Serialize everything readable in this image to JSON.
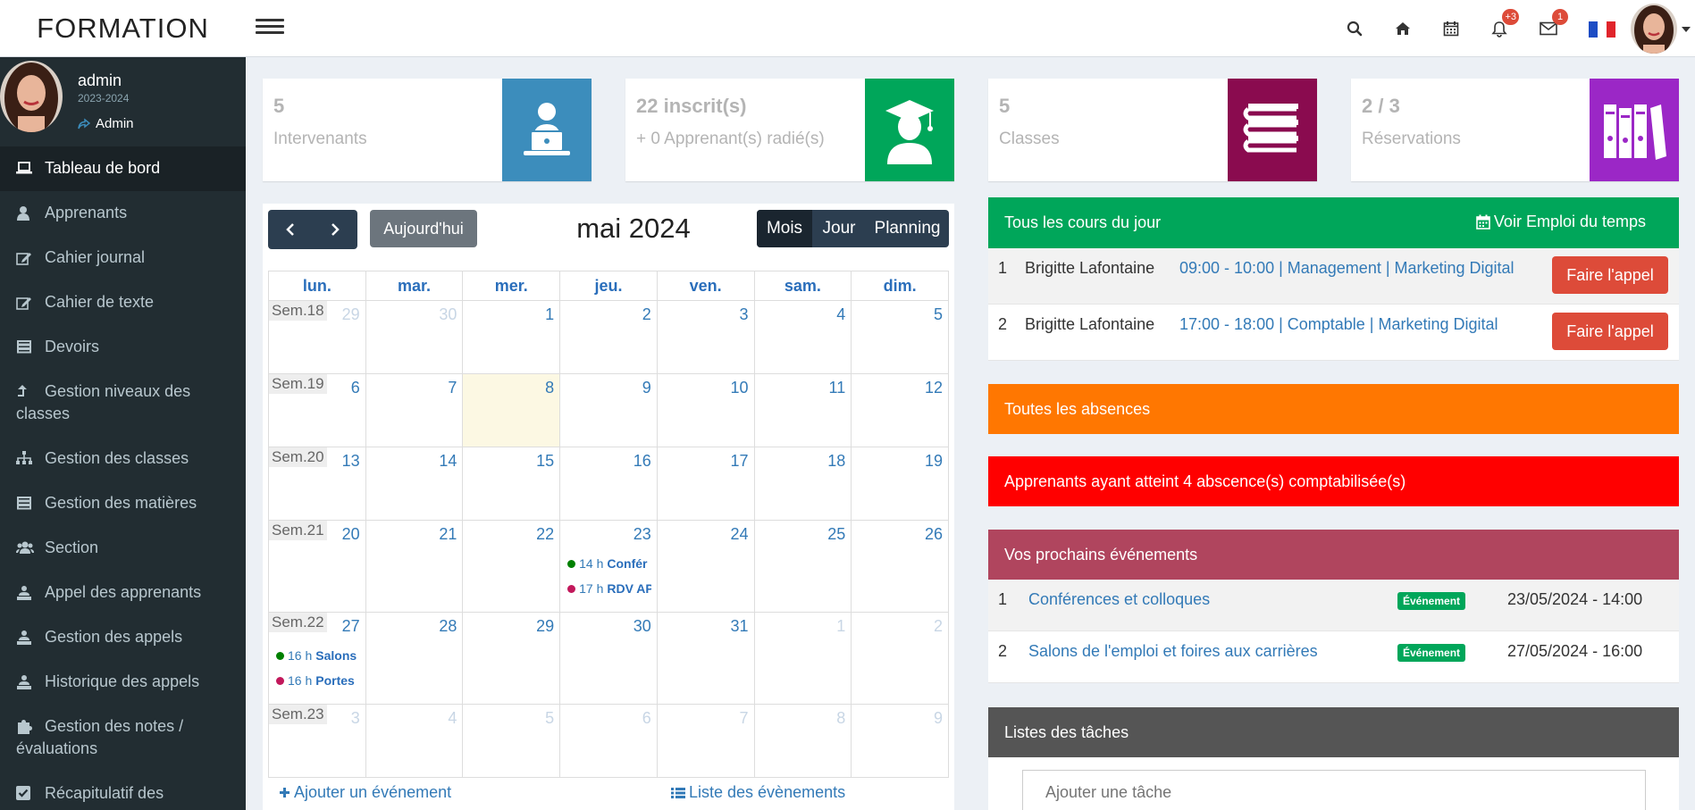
{
  "header": {
    "logo": "FORMATION",
    "badges": {
      "notifications": "+3",
      "messages": "1"
    }
  },
  "user": {
    "name": "admin",
    "year": "2023-2024",
    "role": "Admin"
  },
  "sidebar": {
    "items": [
      {
        "label": "Tableau de bord",
        "icon": "laptop-icon",
        "active": true
      },
      {
        "label": "Apprenants",
        "icon": "user-icon"
      },
      {
        "label": "Cahier journal",
        "icon": "edit-icon"
      },
      {
        "label": "Cahier de texte",
        "icon": "edit-icon"
      },
      {
        "label": "Devoirs",
        "icon": "stack-icon"
      },
      {
        "label": "Gestion niveaux des classes",
        "icon": "level-up-icon"
      },
      {
        "label": "Gestion des classes",
        "icon": "sitemap-icon"
      },
      {
        "label": "Gestion des matières",
        "icon": "stack-icon"
      },
      {
        "label": "Section",
        "icon": "users-icon"
      },
      {
        "label": "Appel des apprenants",
        "icon": "user-group-icon"
      },
      {
        "label": "Gestion des appels",
        "icon": "user-group-icon"
      },
      {
        "label": "Historique des appels",
        "icon": "user-group-icon"
      },
      {
        "label": "Gestion des notes / évaluations",
        "icon": "puzzle-icon"
      },
      {
        "label": "Récapitulatif des",
        "icon": "check-square-icon"
      }
    ]
  },
  "stats": [
    {
      "value": "5",
      "label": "Intervenants",
      "color": "#3c8dbc",
      "icon": "teacher-laptop-icon"
    },
    {
      "value": "22 inscrit(s)",
      "label": "+ 0 Apprenant(s) radié(s)",
      "color": "#00a65a",
      "icon": "graduate-icon"
    },
    {
      "value": "5",
      "label": "Classes",
      "color": "#8a0b4f",
      "icon": "books-stack-icon"
    },
    {
      "value": "2 / 3",
      "label": "Réservations",
      "color": "#9b27c6",
      "icon": "binders-icon"
    }
  ],
  "calendar": {
    "title": "mai 2024",
    "today_button": "Aujourd'hui",
    "views": [
      "Mois",
      "Jour",
      "Planning"
    ],
    "weekdays": [
      "lun.",
      "mar.",
      "mer.",
      "jeu.",
      "ven.",
      "sam.",
      "dim."
    ],
    "weeks": [
      {
        "label": "Sem.18",
        "days": [
          "29",
          "30",
          "1",
          "2",
          "3",
          "4",
          "5"
        ]
      },
      {
        "label": "Sem.19",
        "days": [
          "6",
          "7",
          "8",
          "9",
          "10",
          "11",
          "12"
        ]
      },
      {
        "label": "Sem.20",
        "days": [
          "13",
          "14",
          "15",
          "16",
          "17",
          "18",
          "19"
        ]
      },
      {
        "label": "Sem.21",
        "days": [
          "20",
          "21",
          "22",
          "23",
          "24",
          "25",
          "26"
        ]
      },
      {
        "label": "Sem.22",
        "days": [
          "27",
          "28",
          "29",
          "30",
          "31",
          "1",
          "2"
        ]
      },
      {
        "label": "Sem.23",
        "days": [
          "3",
          "4",
          "5",
          "6",
          "7",
          "8",
          "9"
        ]
      }
    ],
    "events": [
      {
        "time": "14 h",
        "title": "Confér",
        "color": "#008000"
      },
      {
        "time": "17 h",
        "title": "RDV AP",
        "color": "#c2185b"
      },
      {
        "time": "16 h",
        "title": "Salons",
        "color": "#008000"
      },
      {
        "time": "16 h",
        "title": "Portes",
        "color": "#c2185b"
      }
    ],
    "add_event": "Ajouter un événement",
    "event_list": "Liste des évènements"
  },
  "courses": {
    "title": "Tous les cours du jour",
    "link": "Voir Emploi du temps",
    "color": "#00a65a",
    "rows": [
      {
        "index": "1",
        "teacher": "Brigitte Lafontaine",
        "details": "09:00 - 10:00 | Management | Marketing Digital",
        "button": "Faire l'appel"
      },
      {
        "index": "2",
        "teacher": "Brigitte Lafontaine",
        "details": "17:00 - 18:00 | Comptable | Marketing Digital",
        "button": "Faire l'appel"
      }
    ]
  },
  "absences": {
    "title": "Toutes les absences",
    "color": "#ff7701"
  },
  "alerts": {
    "title": "Apprenants ayant atteint 4 abscence(s) comptabilisée(s)",
    "color": "#ff0000"
  },
  "upcoming": {
    "title": "Vos prochains événements",
    "color": "#b0455e",
    "rows": [
      {
        "index": "1",
        "name": "Conférences et colloques",
        "badge": "Événement",
        "date": "23/05/2024 - 14:00"
      },
      {
        "index": "2",
        "name": "Salons de l'emploi et foires aux carrières",
        "badge": "Événement",
        "date": "27/05/2024 - 16:00"
      }
    ]
  },
  "tasks": {
    "title": "Listes des tâches",
    "placeholder": "Ajouter une tâche",
    "color": "#555555"
  }
}
